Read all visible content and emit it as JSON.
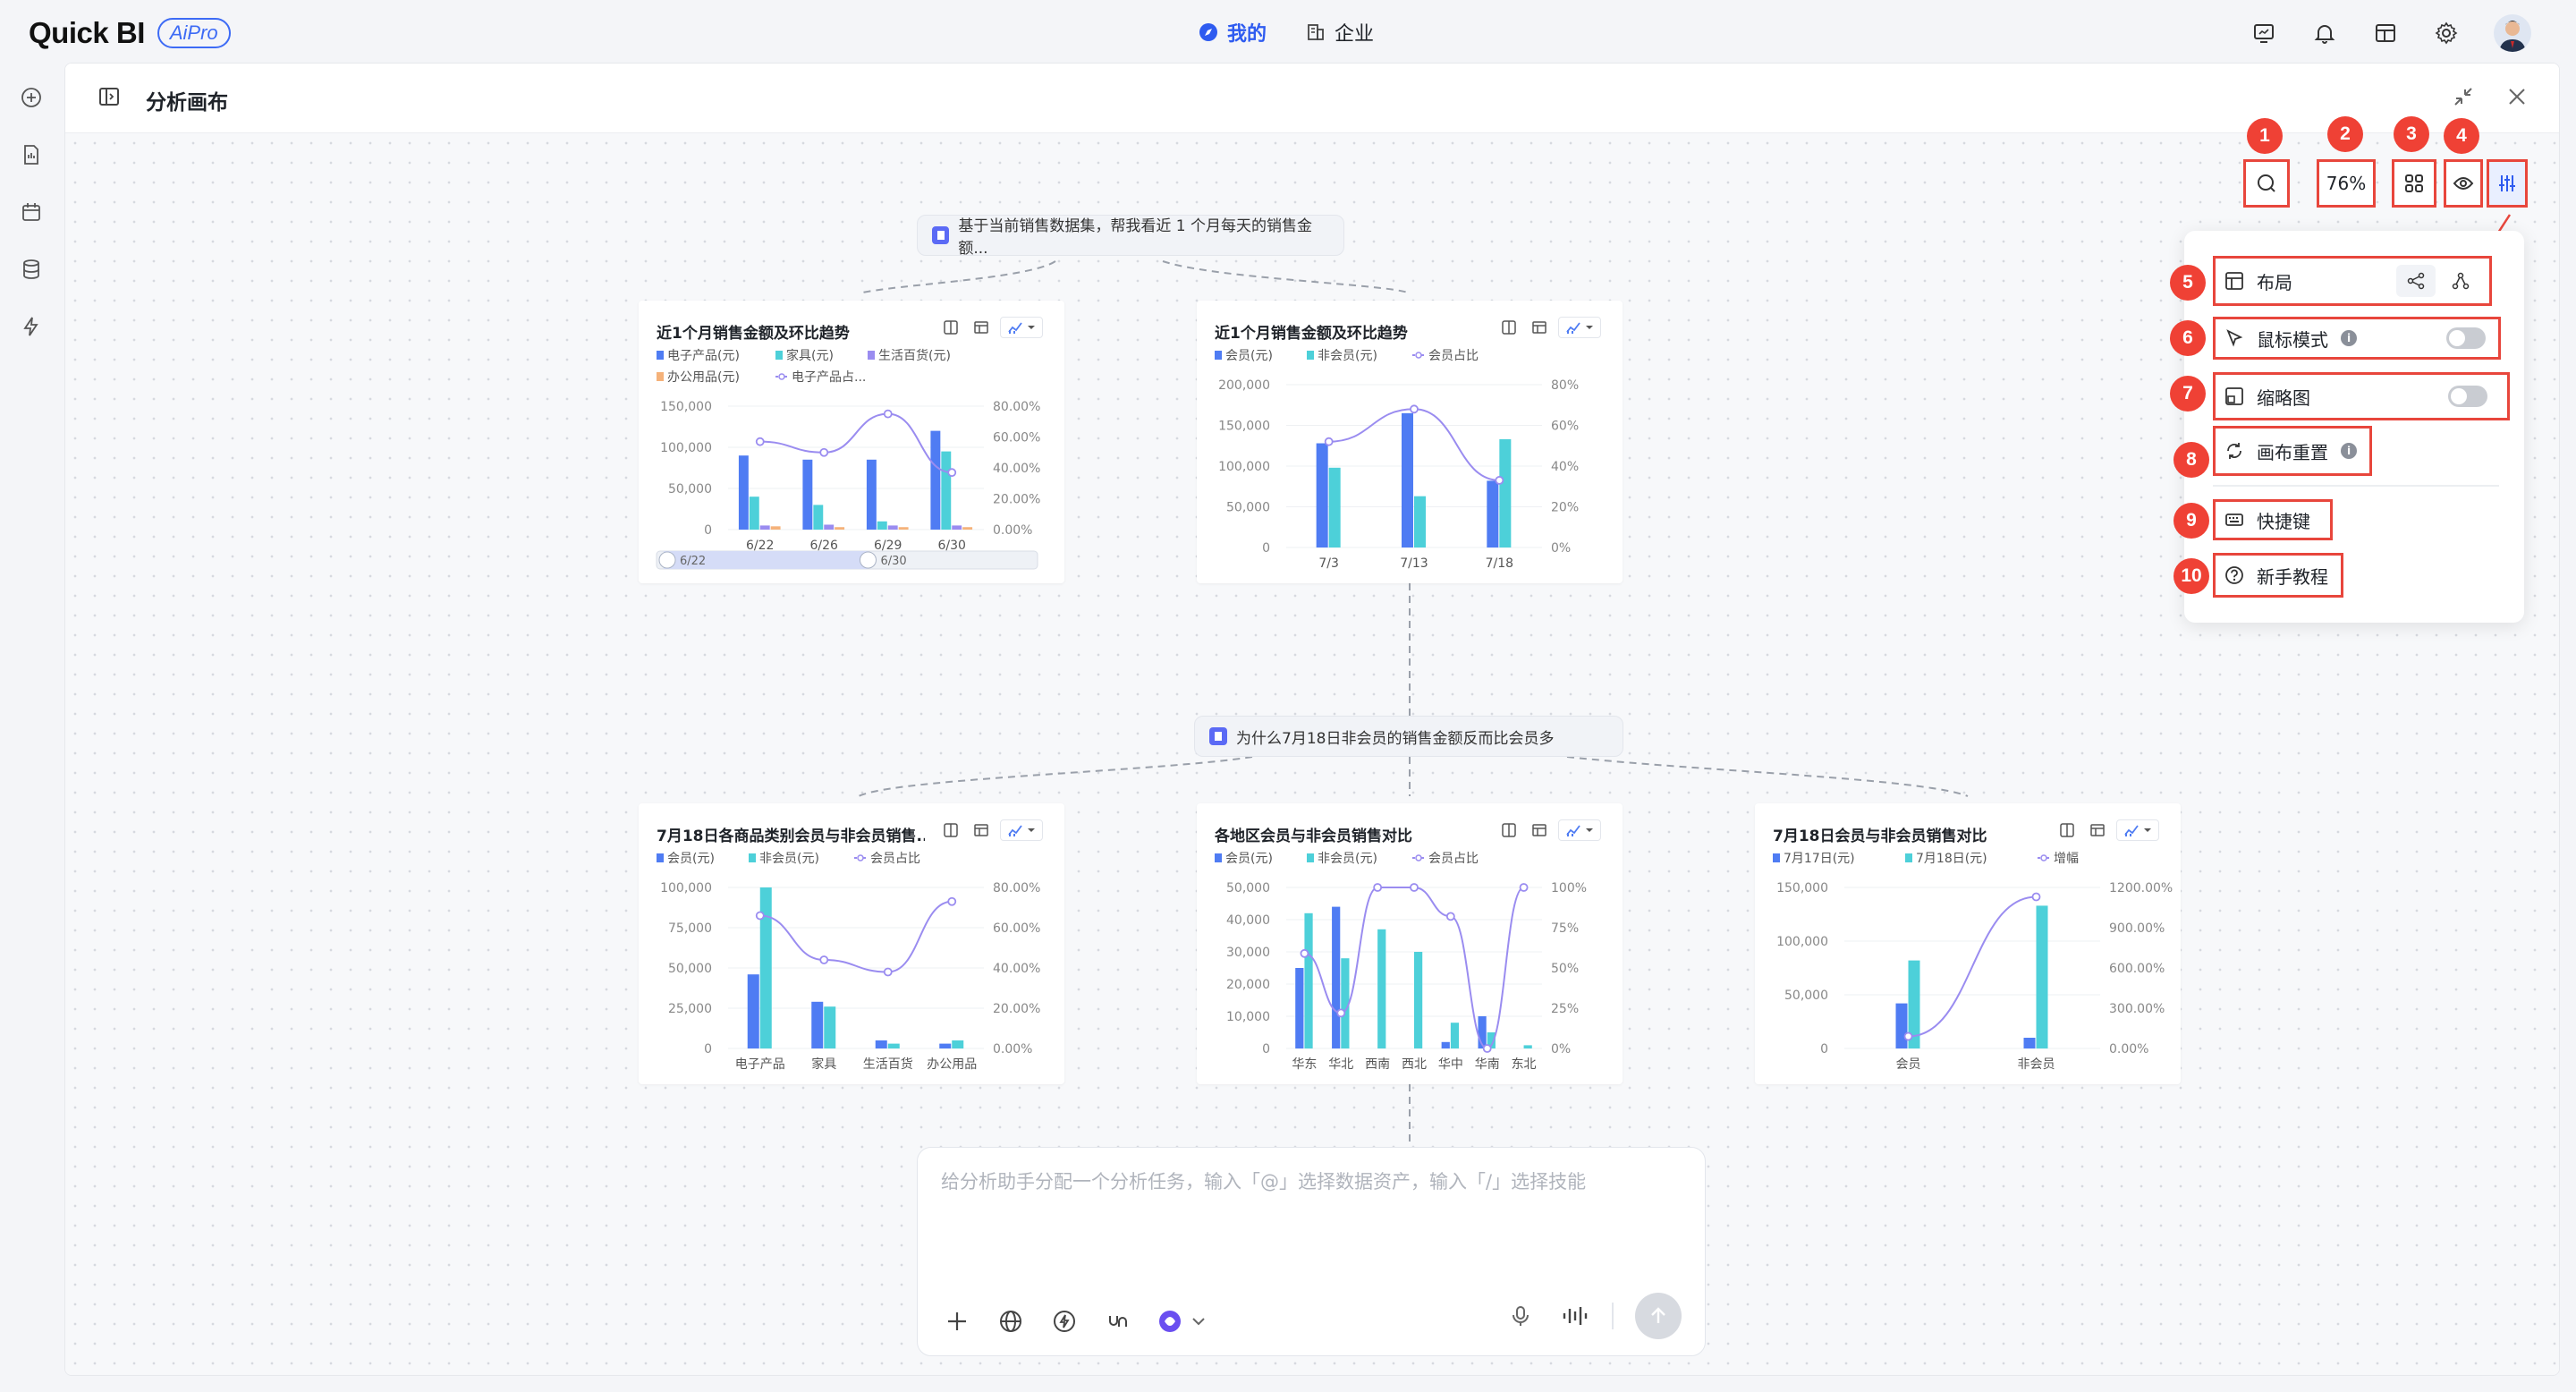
{
  "app": {
    "logo_text": "Quick BI",
    "logo_badge": "AiPro"
  },
  "topnav": [
    {
      "label": "我的",
      "active": true
    },
    {
      "label": "企业",
      "active": false
    }
  ],
  "panel": {
    "title": "分析画布"
  },
  "queries": [
    {
      "text": "基于当前销售数据集，帮我看近 1 个月每天的销售金额..."
    },
    {
      "text": "为什么7月18日非会员的销售金额反而比会员多"
    }
  ],
  "controls": {
    "zoom": "76%"
  },
  "badges": [
    "1",
    "2",
    "3",
    "4",
    "5",
    "6",
    "7",
    "8",
    "9",
    "10"
  ],
  "menu": {
    "layout": "布局",
    "mouse_mode": "鼠标模式",
    "minimap": "缩略图",
    "reset": "画布重置",
    "shortcuts": "快捷键",
    "tutorial": "新手教程",
    "info_glyph": "i"
  },
  "chat": {
    "placeholder": "给分析助手分配一个分析任务，输入「@」选择数据资产，输入「/」选择技能"
  },
  "colors": {
    "series_blue": "#4f7cf3",
    "series_cyan": "#4dd0d9",
    "series_purple": "#9a8cf0",
    "series_orange": "#f5b27a",
    "line_purple": "#9a8cf0",
    "accent": "#2e5bf0",
    "highlight": "#e8463c"
  },
  "chart_data": [
    {
      "id": "c1",
      "type": "bar",
      "title": "近1个月销售金额及环比趋势",
      "legend": [
        "电子产品(元)",
        "家具(元)",
        "生活百货(元)",
        "办公用品(元)",
        "电子产品占..."
      ],
      "categories": [
        "6/22",
        "6/26",
        "6/29",
        "6/30"
      ],
      "y_ticks": [
        "150,000",
        "100,000",
        "50,000",
        "0"
      ],
      "y2_ticks": [
        "80.00%",
        "60.00%",
        "40.00%",
        "20.00%",
        "0.00%"
      ],
      "ylim": [
        0,
        150000
      ],
      "y2lim": [
        0,
        80
      ],
      "series": [
        {
          "name": "电子产品(元)",
          "values": [
            90000,
            85000,
            85000,
            120000
          ]
        },
        {
          "name": "家具(元)",
          "values": [
            40000,
            30000,
            10000,
            95000
          ]
        },
        {
          "name": "生活百货(元)",
          "values": [
            5000,
            6000,
            5000,
            5000
          ]
        },
        {
          "name": "办公用品(元)",
          "values": [
            4000,
            3000,
            3000,
            3000
          ]
        }
      ],
      "line": {
        "name": "电子产品占...",
        "values": [
          57,
          50,
          75,
          37
        ]
      },
      "slider": {
        "start": "6/22",
        "end": "6/30"
      }
    },
    {
      "id": "c2",
      "type": "bar",
      "title": "近1个月销售金额及环比趋势",
      "legend": [
        "会员(元)",
        "非会员(元)",
        "会员占比"
      ],
      "categories": [
        "7/3",
        "7/13",
        "7/18"
      ],
      "y_ticks": [
        "200,000",
        "150,000",
        "100,000",
        "50,000",
        "0"
      ],
      "y2_ticks": [
        "80%",
        "60%",
        "40%",
        "20%",
        "0%"
      ],
      "ylim": [
        0,
        200000
      ],
      "y2lim": [
        0,
        80
      ],
      "series": [
        {
          "name": "会员(元)",
          "values": [
            128000,
            165000,
            82000
          ]
        },
        {
          "name": "非会员(元)",
          "values": [
            98000,
            63000,
            133000
          ]
        }
      ],
      "line": {
        "name": "会员占比",
        "values": [
          52,
          68,
          33
        ]
      }
    },
    {
      "id": "c3",
      "type": "bar",
      "title": "7月18日各商品类别会员与非会员销售...",
      "legend": [
        "会员(元)",
        "非会员(元)",
        "会员占比"
      ],
      "categories": [
        "电子产品",
        "家具",
        "生活百货",
        "办公用品"
      ],
      "y_ticks": [
        "100,000",
        "75,000",
        "50,000",
        "25,000",
        "0"
      ],
      "y2_ticks": [
        "80.00%",
        "60.00%",
        "40.00%",
        "20.00%",
        "0.00%"
      ],
      "ylim": [
        0,
        100000
      ],
      "y2lim": [
        0,
        80
      ],
      "series": [
        {
          "name": "会员(元)",
          "values": [
            46000,
            29000,
            5000,
            3000
          ]
        },
        {
          "name": "非会员(元)",
          "values": [
            100000,
            26000,
            3000,
            5000
          ]
        }
      ],
      "line": {
        "name": "会员占比",
        "values": [
          66,
          44,
          38,
          73
        ]
      }
    },
    {
      "id": "c4",
      "type": "bar",
      "title": "各地区会员与非会员销售对比",
      "legend": [
        "会员(元)",
        "非会员(元)",
        "会员占比"
      ],
      "categories": [
        "华东",
        "华北",
        "西南",
        "西北",
        "华中",
        "华南",
        "东北"
      ],
      "y_ticks": [
        "50,000",
        "40,000",
        "30,000",
        "20,000",
        "10,000",
        "0"
      ],
      "y2_ticks": [
        "100%",
        "75%",
        "50%",
        "25%",
        "0%"
      ],
      "ylim": [
        0,
        50000
      ],
      "y2lim": [
        0,
        100
      ],
      "series": [
        {
          "name": "会员(元)",
          "values": [
            25000,
            44000,
            0,
            0,
            2000,
            10000,
            0
          ]
        },
        {
          "name": "非会员(元)",
          "values": [
            42000,
            28000,
            37000,
            30000,
            8000,
            5000,
            1000
          ]
        }
      ],
      "line": {
        "name": "会员占比",
        "values": [
          59,
          22,
          100,
          100,
          82,
          0,
          100
        ]
      }
    },
    {
      "id": "c5",
      "type": "bar",
      "title": "7月18日会员与非会员销售对比",
      "legend": [
        "7月17日(元)",
        "7月18日(元)",
        "增幅"
      ],
      "categories": [
        "会员",
        "非会员"
      ],
      "y_ticks": [
        "150,000",
        "100,000",
        "50,000",
        "0"
      ],
      "y2_ticks": [
        "1200.00%",
        "900.00%",
        "600.00%",
        "300.00%",
        "0.00%"
      ],
      "ylim": [
        0,
        150000
      ],
      "y2lim": [
        0,
        1200
      ],
      "series": [
        {
          "name": "7月17日(元)",
          "values": [
            42000,
            10000
          ]
        },
        {
          "name": "7月18日(元)",
          "values": [
            82000,
            133000
          ]
        }
      ],
      "line": {
        "name": "增幅",
        "values": [
          90,
          1130
        ]
      }
    }
  ]
}
